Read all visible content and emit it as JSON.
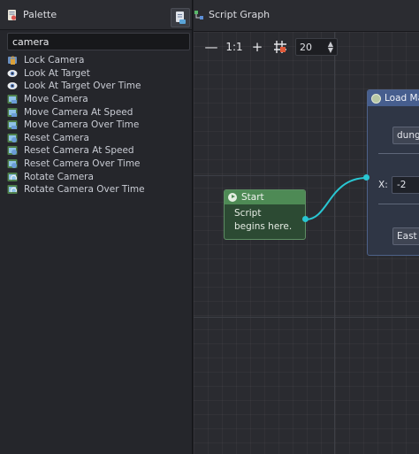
{
  "palette": {
    "title": "Palette",
    "search_value": "camera",
    "items": [
      {
        "label": "Lock Camera",
        "icon": "lock-camera-icon"
      },
      {
        "label": "Look At Target",
        "icon": "eye-icon"
      },
      {
        "label": "Look At Target Over Time",
        "icon": "eye-icon"
      },
      {
        "label": "Move Camera",
        "icon": "camera-move-icon"
      },
      {
        "label": "Move Camera At Speed",
        "icon": "camera-move-icon"
      },
      {
        "label": "Move Camera Over Time",
        "icon": "camera-move-icon"
      },
      {
        "label": "Reset Camera",
        "icon": "camera-reset-icon"
      },
      {
        "label": "Reset Camera At Speed",
        "icon": "camera-reset-icon"
      },
      {
        "label": "Reset Camera Over Time",
        "icon": "camera-reset-icon"
      },
      {
        "label": "Rotate Camera",
        "icon": "camera-rotate-icon"
      },
      {
        "label": "Rotate Camera Over Time",
        "icon": "camera-rotate-icon"
      }
    ]
  },
  "tabbar": {
    "tab_label": "Script Graph"
  },
  "toolbar": {
    "zoom_out": "—",
    "reset_zoom": "1:1",
    "zoom_in": "+",
    "zoom_value": "20"
  },
  "nodes": {
    "start": {
      "title": "Start",
      "body_line1": "Script",
      "body_line2": "begins here."
    },
    "load": {
      "title": "Load Ma",
      "field1": "dungeo",
      "x_label": "X:",
      "x_value": "-2",
      "field2": "East"
    }
  },
  "colors": {
    "wire": "#29c6d2",
    "start_header": "#4e8a55",
    "load_header": "#465e8e"
  }
}
